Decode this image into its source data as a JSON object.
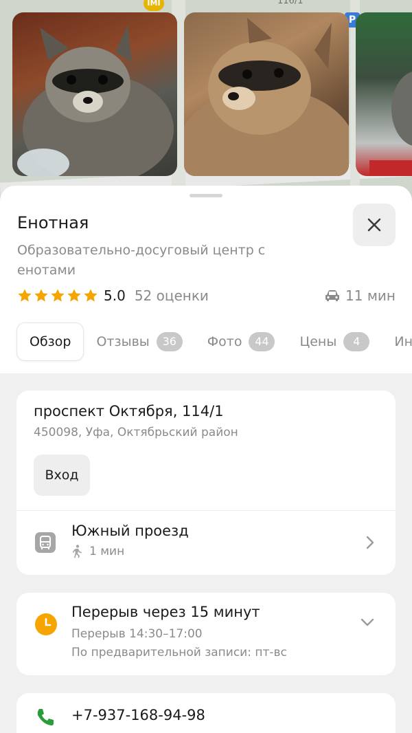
{
  "map": {
    "metro_badge": "IMI",
    "house_number": "116/1",
    "parking_badge": "P"
  },
  "place": {
    "title": "Енотная",
    "subtitle": "Образовательно-досуговый центр с енотами",
    "rating_value": "5.0",
    "rating_stars": 5,
    "rating_count": "52 оценки",
    "travel_time": "11 мин"
  },
  "tabs": [
    {
      "label": "Обзор",
      "count": ""
    },
    {
      "label": "Отзывы",
      "count": "36"
    },
    {
      "label": "Фото",
      "count": "44"
    },
    {
      "label": "Цены",
      "count": "4"
    },
    {
      "label": "Ин",
      "count": ""
    }
  ],
  "address": {
    "street": "проспект Октября, 114/1",
    "details": "450098, Уфа, Октябрьский район",
    "entrance_label": "Вход",
    "stop_name": "Южный проезд",
    "walk_time": "1 мин"
  },
  "hours": {
    "status": "Перерыв через 15 минут",
    "break": "Перерыв 14:30–17:00",
    "note": "По предварительной записи: пт-вс"
  },
  "contact": {
    "phone": "+7-937-168-94-98"
  },
  "colors": {
    "star": "#f5a400",
    "clock": "#f5a400",
    "phone_icon": "#2a9d3a",
    "badge": "#c8c8c8"
  },
  "icons": {
    "close": "close-icon",
    "car": "car-icon",
    "bus": "bus-icon",
    "walk": "walk-icon",
    "clock": "clock-icon",
    "phone": "phone-icon",
    "chevron_right": "chevron-right-icon",
    "chevron_down": "chevron-down-icon"
  }
}
